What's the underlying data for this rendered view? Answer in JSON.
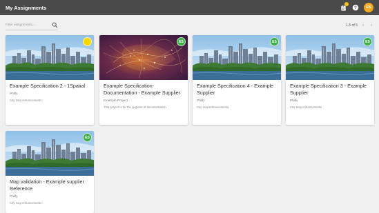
{
  "header": {
    "title": "My Assignments",
    "avatar_initials": "ES",
    "avatar_color": "#f5a623",
    "icons": [
      "assignment-icon",
      "help-icon"
    ]
  },
  "filter": {
    "placeholder": "Filter assignments...",
    "pagination": "1-5 of 5"
  },
  "cards": [
    {
      "title": "Example Specification 2 - 1Spatial",
      "project": "Philly",
      "description": "City map enhancements",
      "badge": "",
      "badge_color": "#f5d800",
      "image": "city"
    },
    {
      "title": "Example Specification-Documentation - Example Supplier",
      "project": "Example Project",
      "description": "This project is for the purpose of documentation",
      "badge": "ES",
      "badge_color": "#3fae49",
      "image": "network"
    },
    {
      "title": "Example Specification 4 - Example Supplier",
      "project": "Philly",
      "description": "City map enhancements",
      "badge": "ES",
      "badge_color": "#3fae49",
      "image": "city"
    },
    {
      "title": "Example Specification 3 - Example Supplier",
      "project": "Philly",
      "description": "City map enhancements",
      "badge": "ES",
      "badge_color": "#3fae49",
      "image": "city"
    },
    {
      "title": "Map validation - Example supplier Reference",
      "project": "Philly",
      "description": "City map enhancements",
      "badge": "ES",
      "badge_color": "#3fae49",
      "image": "city"
    }
  ]
}
